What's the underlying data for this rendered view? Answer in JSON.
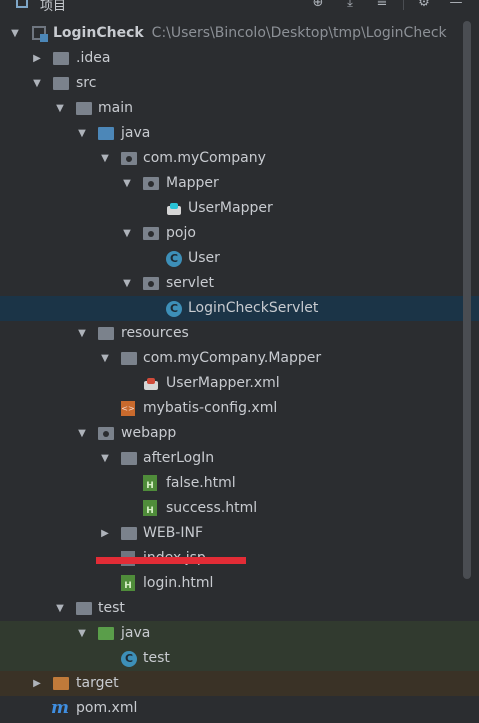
{
  "topbar": {
    "title": "项目",
    "icons": [
      "project-view-icon",
      "locate-icon",
      "collapse-all-icon",
      "expand-icon",
      "settings-icon"
    ]
  },
  "tree": {
    "items": [
      {
        "label": "LoginCheck",
        "path": "C:\\Users\\Bincolo\\Desktop\\tmp\\LoginCheck",
        "icon": "module-icon",
        "expanded": true,
        "depth": 0
      },
      {
        "label": ".idea",
        "icon": "folder-icon",
        "expanded": false,
        "depth": 1
      },
      {
        "label": "src",
        "icon": "folder-icon",
        "expanded": true,
        "depth": 1
      },
      {
        "label": "main",
        "icon": "folder-icon",
        "expanded": true,
        "depth": 2
      },
      {
        "label": "java",
        "icon": "source-folder-icon",
        "expanded": true,
        "depth": 3
      },
      {
        "label": "com.myCompany",
        "icon": "package-icon",
        "expanded": true,
        "depth": 4
      },
      {
        "label": "Mapper",
        "icon": "package-icon",
        "expanded": true,
        "depth": 5
      },
      {
        "label": "UserMapper",
        "icon": "mybatis-mapper-icon",
        "depth": 6
      },
      {
        "label": "pojo",
        "icon": "package-icon",
        "expanded": true,
        "depth": 5
      },
      {
        "label": "User",
        "icon": "class-icon",
        "depth": 6
      },
      {
        "label": "servlet",
        "icon": "package-icon",
        "expanded": true,
        "depth": 5
      },
      {
        "label": "LoginCheckServlet",
        "icon": "class-icon",
        "depth": 6,
        "selected": true
      },
      {
        "label": "resources",
        "icon": "resources-folder-icon",
        "expanded": true,
        "depth": 3
      },
      {
        "label": "com.myCompany.Mapper",
        "icon": "folder-icon",
        "expanded": true,
        "depth": 4
      },
      {
        "label": "UserMapper.xml",
        "icon": "mybatis-xml-icon",
        "depth": 5
      },
      {
        "label": "mybatis-config.xml",
        "icon": "xml-file-icon",
        "depth": 4
      },
      {
        "label": "webapp",
        "icon": "web-folder-icon",
        "expanded": true,
        "depth": 3
      },
      {
        "label": "afterLogIn",
        "icon": "folder-icon",
        "expanded": true,
        "depth": 4
      },
      {
        "label": "false.html",
        "icon": "html-file-icon",
        "depth": 5
      },
      {
        "label": "success.html",
        "icon": "html-file-icon",
        "depth": 5
      },
      {
        "label": "WEB-INF",
        "icon": "folder-icon",
        "expanded": false,
        "depth": 4
      },
      {
        "label": "index.jsp",
        "icon": "jsp-file-icon",
        "depth": 4,
        "redacted": true
      },
      {
        "label": "login.html",
        "icon": "html-file-icon",
        "depth": 4
      },
      {
        "label": "test",
        "icon": "folder-icon",
        "expanded": true,
        "depth": 2
      },
      {
        "label": "java",
        "icon": "test-source-folder-icon",
        "expanded": true,
        "depth": 3
      },
      {
        "label": "test",
        "icon": "test-class-icon",
        "depth": 4
      },
      {
        "label": "target",
        "icon": "excluded-folder-icon",
        "expanded": false,
        "depth": 1
      },
      {
        "label": "pom.xml",
        "icon": "maven-icon",
        "depth": 1
      }
    ]
  },
  "colors": {
    "background": "#2b2d30",
    "selected_row": "#1b3447",
    "test_band": "#313a2f",
    "excluded_band": "#3a3226",
    "text": "#c8cbd0",
    "path_text": "#8c9096",
    "redaction": "#e32c36"
  }
}
